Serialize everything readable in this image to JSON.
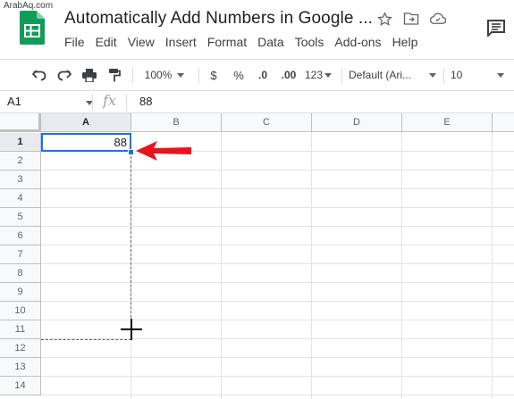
{
  "watermark": "ArabAq.com",
  "document": {
    "title": "Automatically Add Numbers in Google ...",
    "title_icons": [
      "star-icon",
      "move-to-folder-icon",
      "cloud-status-icon"
    ]
  },
  "menu": [
    "File",
    "Edit",
    "View",
    "Insert",
    "Format",
    "Data",
    "Tools",
    "Add-ons",
    "Help"
  ],
  "toolbar": {
    "zoom": "100%",
    "currency": "$",
    "percent": "%",
    "decrease_decimal": ".0",
    "increase_decimal": ".00",
    "more_formats": "123",
    "font": "Default (Ari...",
    "font_size": "10"
  },
  "formula_bar": {
    "name_box": "A1",
    "fx": "fx",
    "value": "88"
  },
  "sheet": {
    "columns": [
      "A",
      "B",
      "C",
      "D",
      "E"
    ],
    "rows": [
      "1",
      "2",
      "3",
      "4",
      "5",
      "6",
      "7",
      "8",
      "9",
      "10",
      "11",
      "12",
      "13",
      "14"
    ],
    "cells": {
      "A1": "88"
    },
    "selected_cell": "A1",
    "fill_range": "A1:A11"
  },
  "colors": {
    "selection": "#1a73e8",
    "annotation_arrow": "#e8141c",
    "sheets_green": "#0f9d58"
  }
}
